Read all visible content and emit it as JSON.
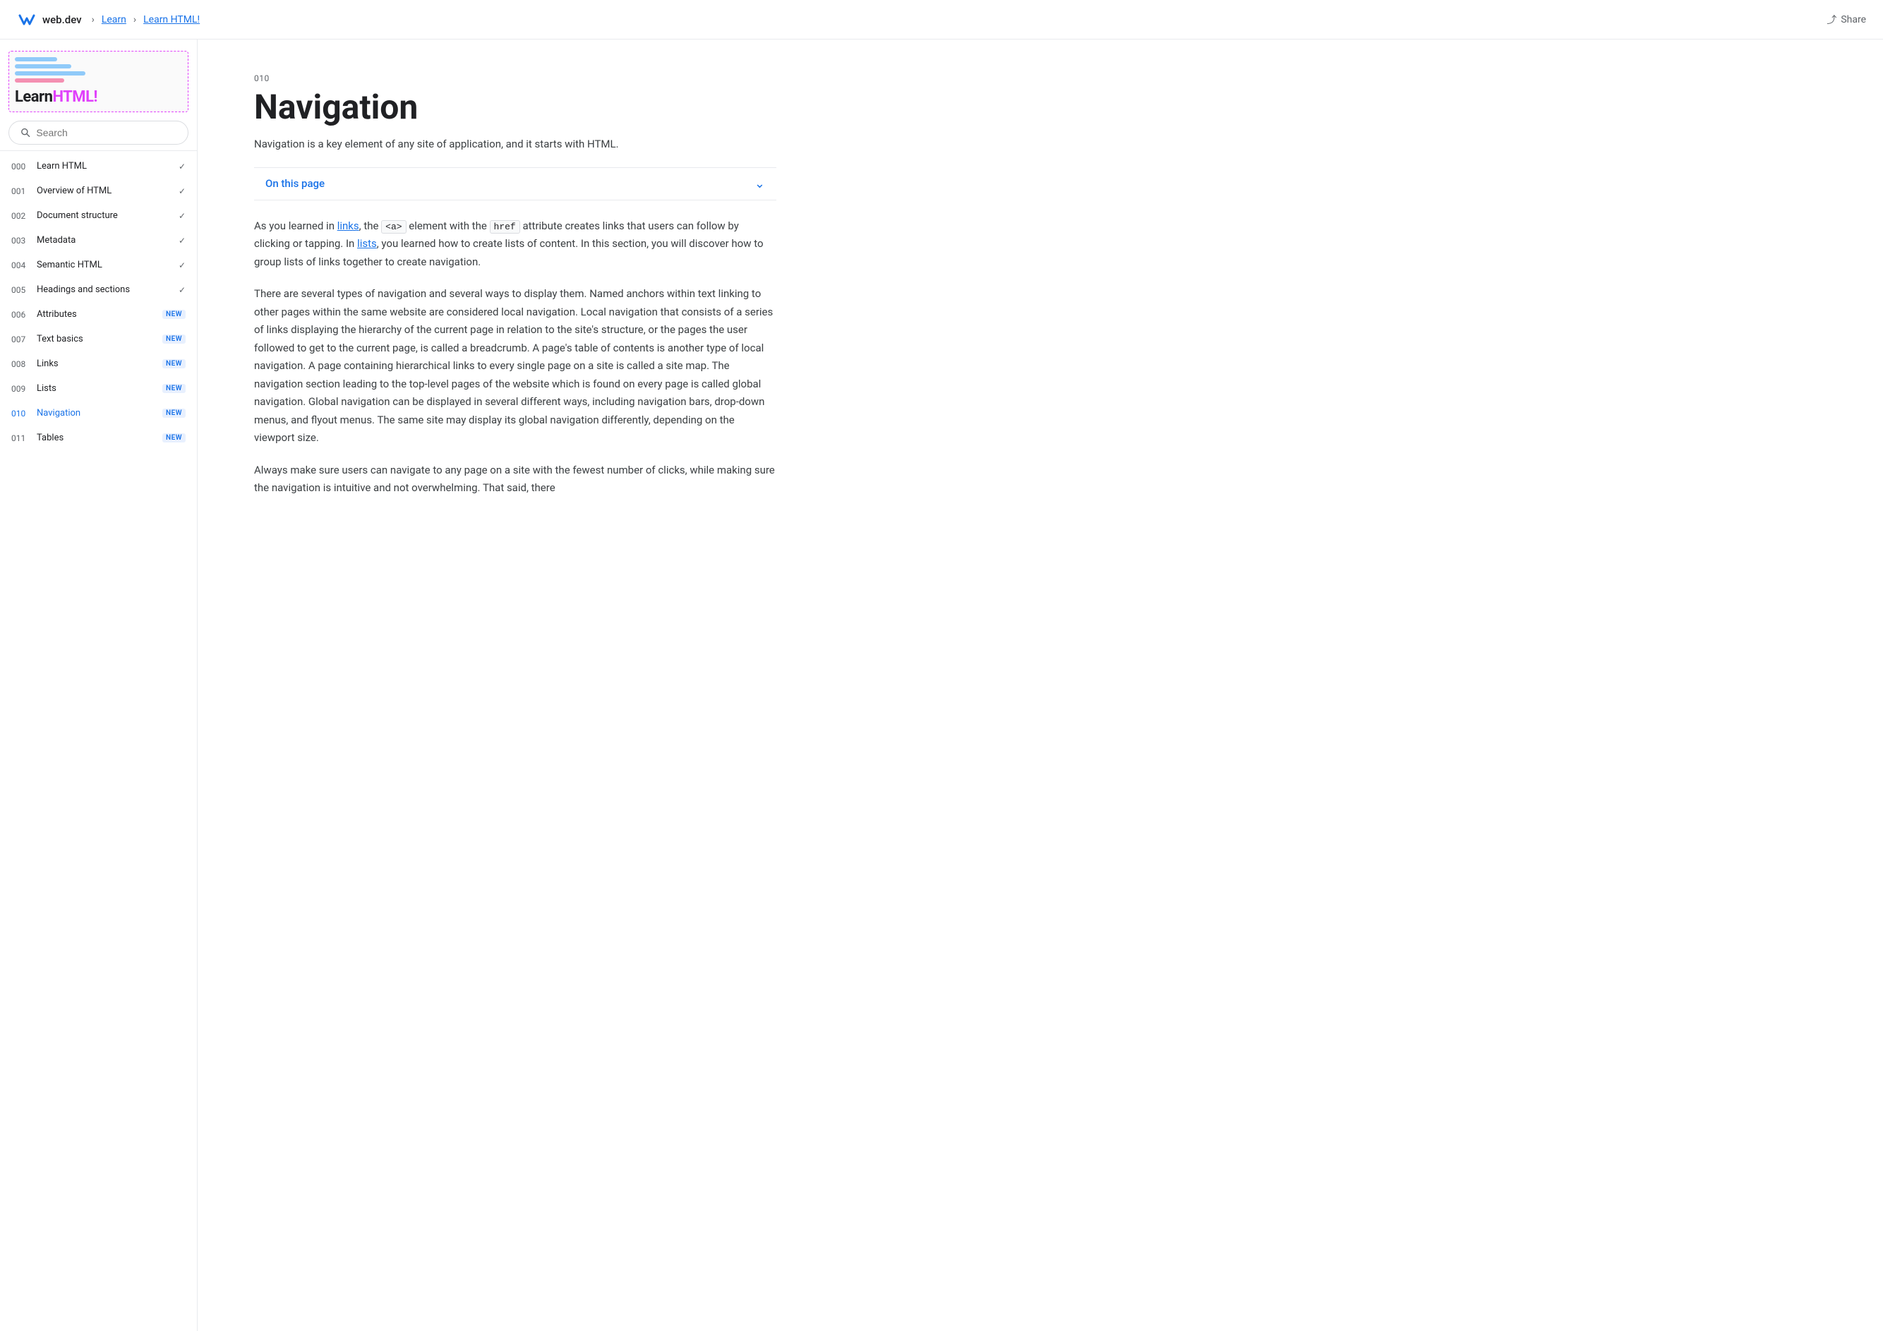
{
  "topnav": {
    "site_name": "web.dev",
    "breadcrumbs": [
      "Learn",
      "Learn HTML!"
    ],
    "share_label": "Share"
  },
  "sidebar": {
    "title": {
      "learn_part": "Learn",
      "html_part": "HTML!"
    },
    "search_placeholder": "Search",
    "nav_items": [
      {
        "number": "000",
        "label": "Learn HTML",
        "badge": "",
        "check": true,
        "active": false
      },
      {
        "number": "001",
        "label": "Overview of HTML",
        "badge": "",
        "check": true,
        "active": false
      },
      {
        "number": "002",
        "label": "Document structure",
        "badge": "",
        "check": true,
        "active": false
      },
      {
        "number": "003",
        "label": "Metadata",
        "badge": "",
        "check": true,
        "active": false
      },
      {
        "number": "004",
        "label": "Semantic HTML",
        "badge": "",
        "check": true,
        "active": false
      },
      {
        "number": "005",
        "label": "Headings and sections",
        "badge": "",
        "check": true,
        "active": false
      },
      {
        "number": "006",
        "label": "Attributes",
        "badge": "NEW",
        "check": false,
        "active": false
      },
      {
        "number": "007",
        "label": "Text basics",
        "badge": "NEW",
        "check": false,
        "active": false
      },
      {
        "number": "008",
        "label": "Links",
        "badge": "NEW",
        "check": false,
        "active": false
      },
      {
        "number": "009",
        "label": "Lists",
        "badge": "NEW",
        "check": false,
        "active": false
      },
      {
        "number": "010",
        "label": "Navigation",
        "badge": "NEW",
        "check": false,
        "active": true
      },
      {
        "number": "011",
        "label": "Tables",
        "badge": "NEW",
        "check": false,
        "active": false
      }
    ]
  },
  "content": {
    "number": "010",
    "title": "Navigation",
    "subtitle": "Navigation is a key element of any site of application, and it starts with HTML.",
    "on_this_page": "On this page",
    "body_p1_pre": "As you learned in ",
    "body_p1_link1": "links",
    "body_p1_mid1": ", the ",
    "body_p1_code1": "<a>",
    "body_p1_mid2": " element with the ",
    "body_p1_code2": "href",
    "body_p1_mid3": " attribute creates links that users can follow by clicking or tapping. In ",
    "body_p1_link2": "lists",
    "body_p1_end": ", you learned how to create lists of content. In this section, you will discover how to group lists of links together to create navigation.",
    "body_p2": "There are several types of navigation and several ways to display them. Named anchors within text linking to other pages within the same website are considered local navigation. Local navigation that consists of a series of links displaying the hierarchy of the current page in relation to the site's structure, or the pages the user followed to get to the current page, is called a breadcrumb. A page's table of contents is another type of local navigation. A page containing hierarchical links to every single page on a site is called a site map. The navigation section leading to the top-level pages of the website which is found on every page is called global navigation. Global navigation can be displayed in several different ways, including navigation bars, drop-down menus, and flyout menus. The same site may display its global navigation differently, depending on the viewport size.",
    "body_p3": "Always make sure users can navigate to any page on a site with the fewest number of clicks, while making sure the navigation is intuitive and not overwhelming. That said, there"
  }
}
